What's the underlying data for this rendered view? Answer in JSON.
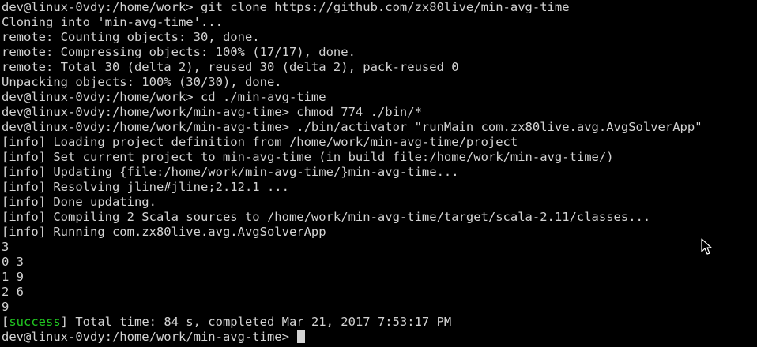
{
  "terminal": {
    "lines": [
      "dev@linux-0vdy:/home/work> git clone https://github.com/zx80live/min-avg-time",
      "Cloning into 'min-avg-time'...",
      "remote: Counting objects: 30, done.",
      "remote: Compressing objects: 100% (17/17), done.",
      "remote: Total 30 (delta 2), reused 30 (delta 2), pack-reused 0",
      "Unpacking objects: 100% (30/30), done.",
      "dev@linux-0vdy:/home/work> cd ./min-avg-time",
      "dev@linux-0vdy:/home/work/min-avg-time> chmod 774 ./bin/*",
      "dev@linux-0vdy:/home/work/min-avg-time> ./bin/activator \"runMain com.zx80live.avg.AvgSolverApp\"",
      "[info] Loading project definition from /home/work/min-avg-time/project",
      "[info] Set current project to min-avg-time (in build file:/home/work/min-avg-time/)",
      "[info] Updating {file:/home/work/min-avg-time/}min-avg-time...",
      "[info] Resolving jline#jline;2.12.1 ...",
      "[info] Done updating.",
      "[info] Compiling 2 Scala sources to /home/work/min-avg-time/target/scala-2.11/classes...",
      "[info] Running com.zx80live.avg.AvgSolverApp",
      "3",
      "0 3",
      "1 9",
      "2 6",
      "9"
    ],
    "success_line": {
      "open_bracket": "[",
      "word": "success",
      "rest": "] Total time: 84 s, completed Mar 21, 2017 7:53:17 PM"
    },
    "prompt": "dev@linux-0vdy:/home/work/min-avg-time> ",
    "colors": {
      "background": "#000000",
      "foreground": "#d3d3d3",
      "success": "#21c721"
    }
  }
}
